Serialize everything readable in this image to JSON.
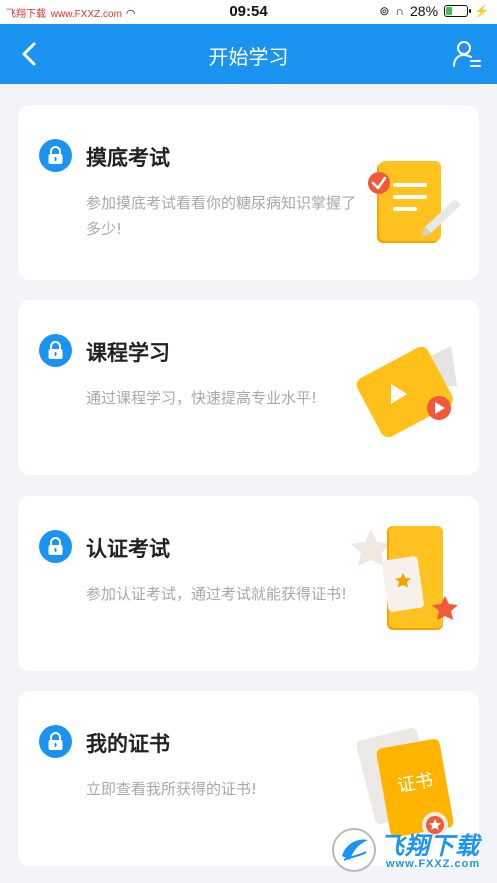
{
  "status_bar": {
    "left_text": "飞翔下载",
    "left_url": "www.FXXZ.com",
    "time": "09:54",
    "battery": "28%"
  },
  "header": {
    "title": "开始学习"
  },
  "cards": [
    {
      "title": "摸底考试",
      "desc": "参加摸底考试看看你的糖尿病知识掌握了多少!"
    },
    {
      "title": "课程学习",
      "desc": "通过课程学习，快速提高专业水平!"
    },
    {
      "title": "认证考试",
      "desc": "参加认证考试，通过考试就能获得证书!"
    },
    {
      "title": "我的证书",
      "desc": "立即查看我所获得的证书!"
    }
  ],
  "certificate_text": "证书",
  "watermark": {
    "brand": "飞翔下载",
    "url": "www.FXXZ.com"
  },
  "colors": {
    "primary": "#1b93f0",
    "accent_orange": "#f5a300",
    "accent_red": "#f0593a"
  },
  "icons": [
    "back-arrow-icon",
    "user-list-icon",
    "lock-icon",
    "exam-paper-icon",
    "video-play-icon",
    "certificate-card-icon",
    "certificate-book-icon"
  ]
}
